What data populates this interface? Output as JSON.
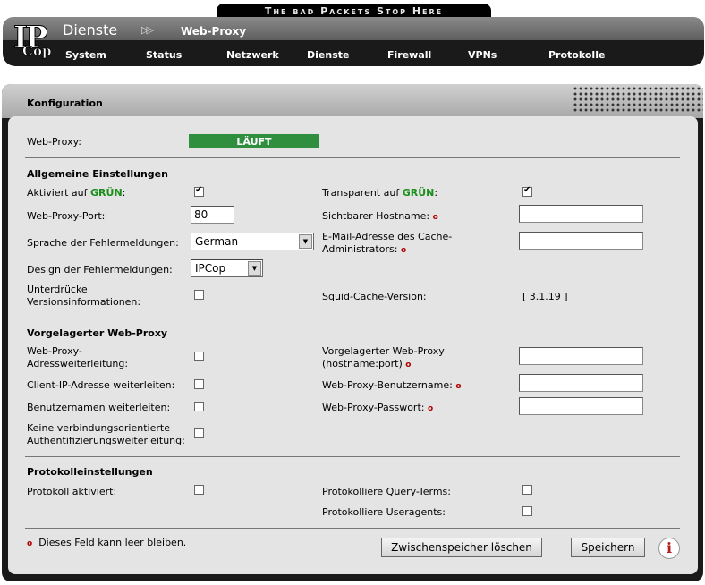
{
  "slogan": "The bad Packets Stop Here",
  "logo": {
    "line1": "IP",
    "line2": "Cop"
  },
  "breadcrumb": {
    "section": "Dienste",
    "arrow": "▷▷",
    "page": "Web-Proxy"
  },
  "menu": [
    "System",
    "Status",
    "Netzwerk",
    "Dienste",
    "Firewall",
    "VPNs",
    "Protokolle"
  ],
  "box_title": "Konfiguration",
  "status": {
    "label": "Web-Proxy:",
    "value": "LÄUFT",
    "color": "#2f8f3f"
  },
  "general": {
    "title": "Allgemeine Einstellungen",
    "enabled_green": {
      "label_prefix": "Aktiviert auf ",
      "label_green": "GRÜN",
      "label_suffix": ":",
      "checked": true
    },
    "transparent_green": {
      "label_prefix": "Transparent auf ",
      "label_green": "GRÜN",
      "label_suffix": ":",
      "checked": true
    },
    "port": {
      "label": "Web-Proxy-Port:",
      "value": "80"
    },
    "visible_hostname": {
      "label": "Sichtbarer Hostname:",
      "value": ""
    },
    "error_language": {
      "label": "Sprache der Fehlermeldungen:",
      "value": "German"
    },
    "admin_email": {
      "label_line1": "E-Mail-Adresse des Cache-",
      "label_line2": "Administrators:",
      "value": ""
    },
    "error_design": {
      "label": "Design der Fehlermeldungen:",
      "value": "IPCop"
    },
    "suppress_version": {
      "label_line1": "Unterdrücke",
      "label_line2": "Versionsinformationen:",
      "checked": false
    },
    "squid_version": {
      "label": "Squid-Cache-Version:",
      "value": "[ 3.1.19 ]"
    }
  },
  "upstream": {
    "title": "Vorgelagerter Web-Proxy",
    "address_forward": {
      "label_line1": "Web-Proxy-",
      "label_line2": "Adressweiterleitung:",
      "checked": false
    },
    "upstream_proxy": {
      "label_line1": "Vorgelagerter Web-Proxy",
      "label_line2": "(hostname:port)",
      "value": ""
    },
    "client_ip_forward": {
      "label": "Client-IP-Adresse weiterleiten:",
      "checked": false
    },
    "proxy_username": {
      "label": "Web-Proxy-Benutzername:",
      "value": ""
    },
    "username_forward": {
      "label": "Benutzernamen weiterleiten:",
      "checked": false
    },
    "proxy_password": {
      "label": "Web-Proxy-Passwort:",
      "value": ""
    },
    "no_conn_auth": {
      "label_line1": "Keine verbindungsorientierte",
      "label_line2": "Authentifizierungsweiterleitung:",
      "checked": false
    }
  },
  "logging": {
    "title": "Protokolleinstellungen",
    "log_enabled": {
      "label": "Protokoll aktiviert:",
      "checked": false
    },
    "log_query_terms": {
      "label": "Protokolliere Query-Terms:",
      "checked": false
    },
    "log_useragents": {
      "label": "Protokolliere Useragents:",
      "checked": false
    }
  },
  "footer": {
    "required_marker": "o",
    "note": "Dieses Feld kann leer bleiben.",
    "clear_cache_button": "Zwischenspeicher löschen",
    "save_button": "Speichern",
    "info_icon": "i"
  },
  "colors": {
    "green_text": "#1b8f1b",
    "required": "#b00000",
    "status_bg": "#2f8f3f"
  }
}
